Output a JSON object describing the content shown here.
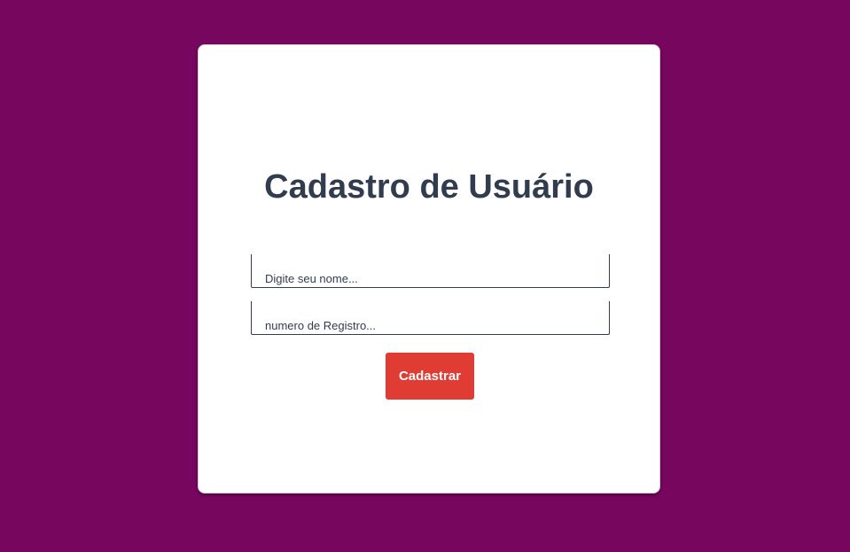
{
  "form": {
    "title": "Cadastro de Usuário",
    "name_field": {
      "value": "",
      "placeholder": "Digite seu nome..."
    },
    "registro_field": {
      "value": "",
      "placeholder": "numero de Registro..."
    },
    "submit_label": "Cadastrar"
  },
  "colors": {
    "background": "#76065e",
    "card": "#ffffff",
    "title_text": "#323c4f",
    "button": "#e03c33",
    "button_text": "#ffffff"
  }
}
